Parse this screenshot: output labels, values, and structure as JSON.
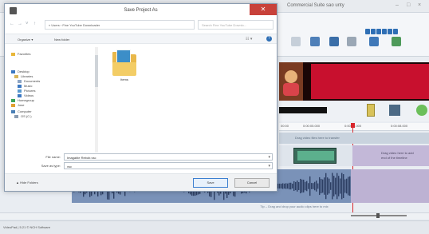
{
  "app": {
    "title": "Commercial Suite sao unty",
    "window_controls": [
      "–",
      "□",
      "×"
    ]
  },
  "dialog": {
    "title": "Save Project As",
    "close_glyph": "✕",
    "address": "« Users › Fine YouTube Downloader",
    "search_placeholder": "Search Fine YouTube Downlo...",
    "organize": "Organize ▾",
    "new_folder": "New folder",
    "view_glyph": "☷ ▾",
    "help_glyph": "?",
    "nav_items": [
      {
        "label": "Favorites",
        "icon": "star-icon",
        "color": "#e8b73a"
      },
      {
        "label": "Desktop",
        "icon": "desktop-icon",
        "color": "#3b78c2"
      },
      {
        "label": "Libraries",
        "icon": "library-icon",
        "color": "#d7b55a"
      },
      {
        "label": "Documents",
        "icon": "document-icon",
        "color": "#8da5c4"
      },
      {
        "label": "Music",
        "icon": "music-icon",
        "color": "#3b78c2"
      },
      {
        "label": "Pictures",
        "icon": "pictures-icon",
        "color": "#5a9ad0"
      },
      {
        "label": "Videos",
        "icon": "videos-icon",
        "color": "#3b78c2"
      },
      {
        "label": "Homegroup",
        "icon": "homegroup-icon",
        "color": "#3aa55a"
      },
      {
        "label": "Jose",
        "icon": "user-icon",
        "color": "#e0a030"
      },
      {
        "label": "Computer",
        "icon": "computer-icon",
        "color": "#4a7fb5"
      },
      {
        "label": "OS (C:)",
        "icon": "drive-icon",
        "color": "#8a9bb0"
      }
    ],
    "folder_label": "Items",
    "file_name_label": "File name:",
    "file_name_value": "Imagable Rebob.vsc",
    "save_type_label": "Save as type:",
    "save_type_value": "vsc",
    "hide_folders": "▲ Hide Folders",
    "save": "Save",
    "cancel": "Cancel"
  },
  "timeline": {
    "ticks": [
      "00:00",
      "0:00:05.000",
      "0:00:06.000",
      "0:00:08.000"
    ],
    "video_hint": "Drag video files here to transfer",
    "clip_hint": "Drag video here to add\nend of the timeline",
    "audio_hint": "Tip – Drag and drop your audio clips here to mix"
  },
  "status": "VideoPad | 5.21 © NCH Software"
}
